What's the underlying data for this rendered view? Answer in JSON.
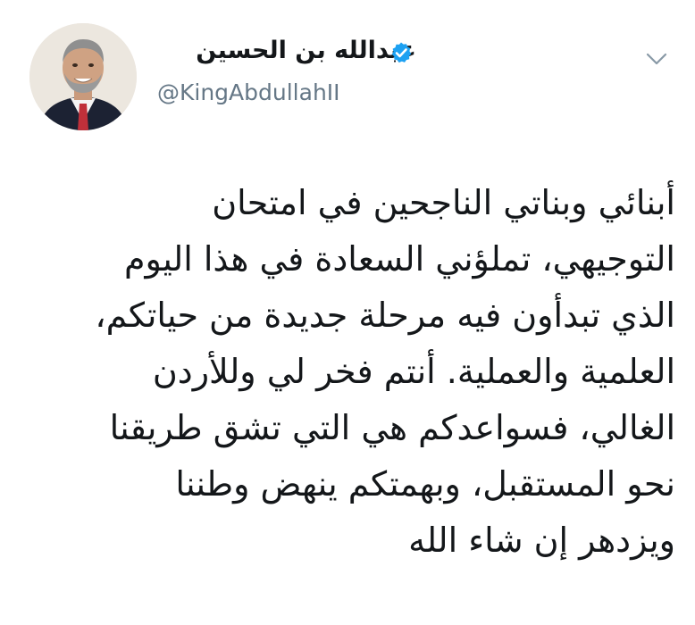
{
  "profile": {
    "display_name": "عبدالله بن الحسين",
    "handle": "@KingAbdullahII",
    "verified_icon": "verified-badge-icon",
    "menu_icon": "chevron-down-icon",
    "accent_color": "#1da1f2"
  },
  "tweet": {
    "lines": [
      "أبنائي وبناتي الناجحين في امتحان",
      "التوجيهي، تملؤني السعادة في هذا اليوم",
      "الذي تبدأون فيه مرحلة جديدة من حياتكم،",
      "العلمية والعملية. أنتم فخر لي وللأردن",
      "الغالي، فسواعدكم هي التي تشق طريقنا",
      "نحو المستقبل، وبهمتكم ينهض وطننا",
      "ويزدهر إن شاء الله"
    ]
  }
}
